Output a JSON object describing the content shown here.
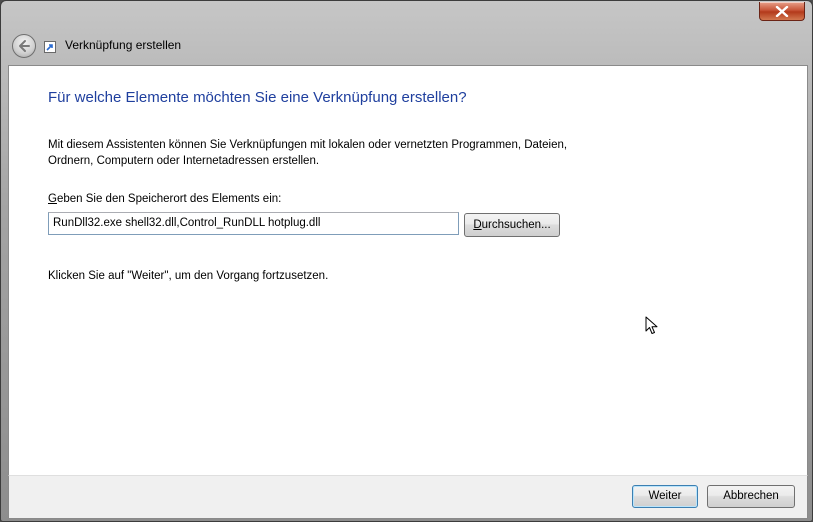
{
  "window": {
    "title": "Verknüpfung erstellen"
  },
  "content": {
    "heading": "Für welche Elemente möchten Sie eine Verknüpfung erstellen?",
    "description": "Mit diesem Assistenten können Sie Verknüpfungen mit lokalen oder vernetzten Programmen, Dateien, Ordnern, Computern oder Internetadressen erstellen.",
    "field_label_accesskey": "G",
    "field_label_rest": "eben Sie den Speicherort des Elements ein:",
    "path_value": "RunDll32.exe shell32.dll,Control_RunDLL hotplug.dll",
    "browse_label_accesskey": "D",
    "browse_label_rest": "urchsuchen...",
    "hint": "Klicken Sie auf \"Weiter\", um den Vorgang fortzusetzen."
  },
  "footer": {
    "next_label": "Weiter",
    "cancel_label": "Abbrechen"
  },
  "icons": {
    "close": "close-icon",
    "back": "back-arrow-icon",
    "app": "shortcut-icon",
    "cursor": "mouse-pointer-icon"
  },
  "colors": {
    "heading": "#1f3f9e",
    "close_button": "#c85538"
  }
}
